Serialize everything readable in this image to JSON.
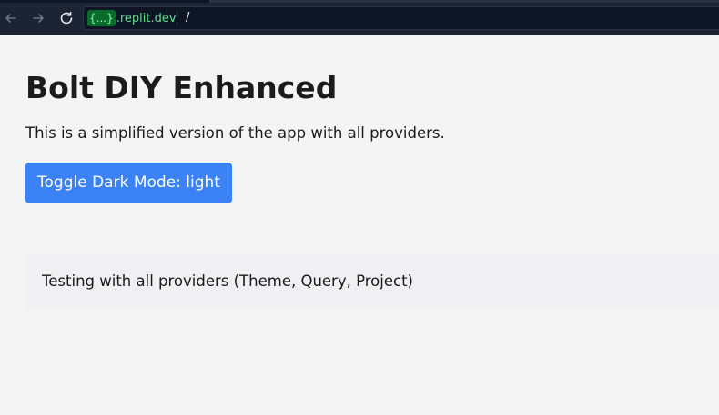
{
  "browser": {
    "host_badge": "{...}",
    "host_suffix": ".replit.dev",
    "path": "/",
    "icons": {
      "back": "back-arrow-icon",
      "forward": "forward-arrow-icon",
      "reload": "reload-icon"
    }
  },
  "page": {
    "title": "Bolt DIY Enhanced",
    "description": "This is a simplified version of the app with all providers.",
    "toggle_button_label": "Toggle Dark Mode: light",
    "providers_text": "Testing with all providers (Theme, Query, Project)"
  },
  "colors": {
    "browser_bar": "#1c2333",
    "url_host": "#5de08c",
    "page_background": "#f4f4f5",
    "button_accent": "#3b82f6",
    "text": "#1b1b1b"
  }
}
